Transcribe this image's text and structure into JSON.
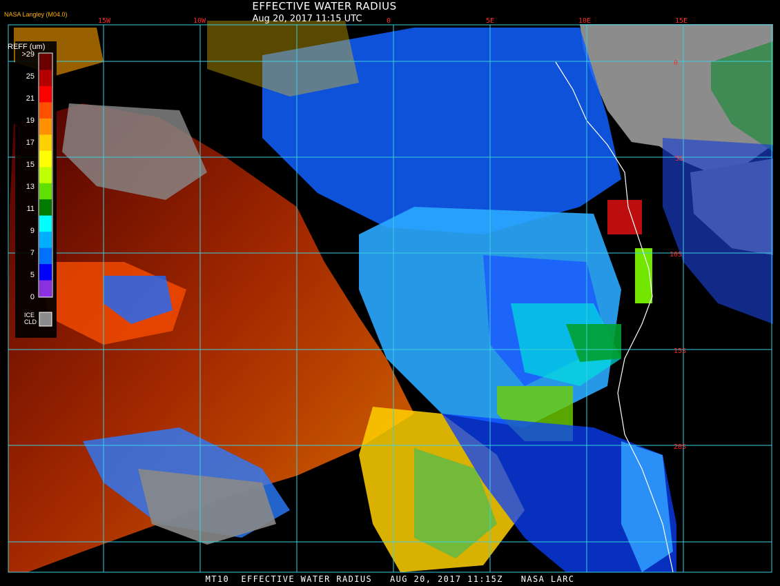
{
  "header": {
    "title": "EFFECTIVE WATER RADIUS",
    "datetime": "Aug 20, 2017 11:15 UTC",
    "credit": "NASA Langley (M04.0)"
  },
  "footer": {
    "text": "MT10  EFFECTIVE WATER RADIUS   AUG 20, 2017 11:15Z   NASA LARC"
  },
  "map": {
    "longitude_labels": [
      "15W",
      "10W",
      "0",
      "5E",
      "10E",
      "15E"
    ],
    "latitude_labels": [
      "0",
      "5S",
      "10S",
      "15S",
      "20S"
    ],
    "colors": {
      "background": "#000000",
      "gridline": "#3ad0e0",
      "coastline": "#ffffff",
      "label": "#ff2a2a",
      "land": "#8c8c8c"
    }
  },
  "legend": {
    "title": "REFF (um)",
    "ice_label_line1": "ICE",
    "ice_label_line2": "CLD",
    "tick_labels": [
      ">29",
      "25",
      "21",
      "19",
      "17",
      "15",
      "13",
      "11",
      "9",
      "7",
      "5",
      "0"
    ],
    "swatches": [
      "#6a0000",
      "#b40000",
      "#ff0000",
      "#ff5000",
      "#ff9000",
      "#ffd000",
      "#ffff00",
      "#c0ff00",
      "#60e000",
      "#007a00",
      "#00ffff",
      "#00b0ff",
      "#0070ff",
      "#0000ff",
      "#8a30e0"
    ],
    "ice_color": "#8c8c8c"
  }
}
